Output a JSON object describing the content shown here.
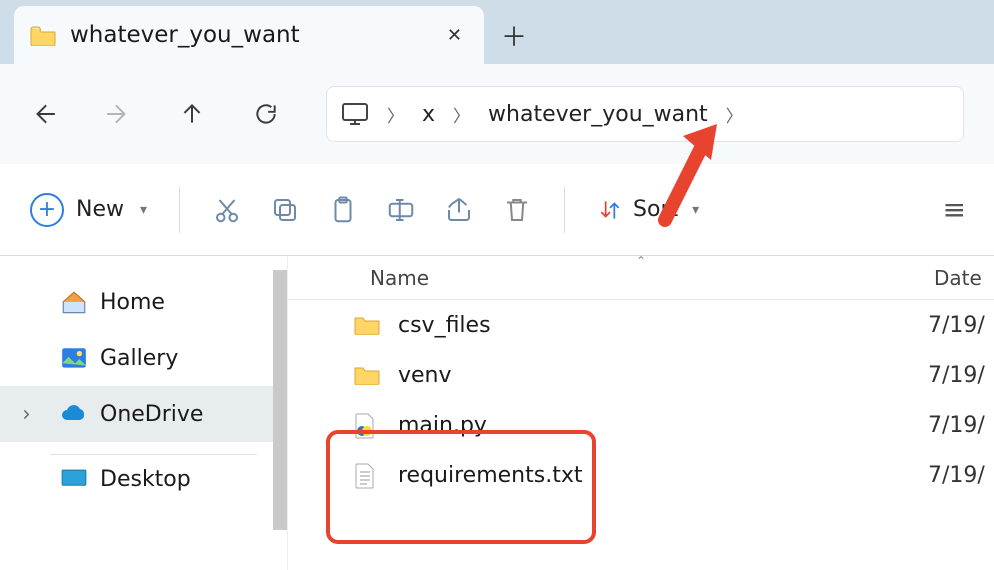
{
  "tab": {
    "title": "whatever_you_want"
  },
  "breadcrumb": {
    "segments": [
      "x",
      "whatever_you_want"
    ]
  },
  "toolbar": {
    "new_label": "New",
    "sort_label": "Sort"
  },
  "sidebar": {
    "items": [
      {
        "label": "Home"
      },
      {
        "label": "Gallery"
      },
      {
        "label": "OneDrive"
      },
      {
        "label": "Desktop"
      }
    ]
  },
  "columns": {
    "name": "Name",
    "date": "Date"
  },
  "files": [
    {
      "name": "csv_files",
      "date": "7/19/"
    },
    {
      "name": "venv",
      "date": "7/19/"
    },
    {
      "name": "main.py",
      "date": "7/19/"
    },
    {
      "name": "requirements.txt",
      "date": "7/19/"
    }
  ]
}
